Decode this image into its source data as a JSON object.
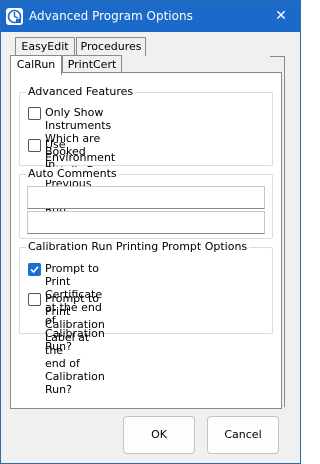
{
  "window": {
    "title": "Advanced Program Options",
    "close_glyph": "✕",
    "app_icon": "calibration-app-icon"
  },
  "tabs_back": [
    {
      "label": "EasyEdit"
    },
    {
      "label": "Procedures"
    }
  ],
  "tabs_front": [
    {
      "label": "CalRun",
      "active": true
    },
    {
      "label": "PrintCert",
      "active": false
    }
  ],
  "advanced_features": {
    "title": "Advanced Features",
    "options": [
      {
        "line1": "Only Show Instruments Which are Booked",
        "line2": "In.",
        "checked": false
      },
      {
        "line1": "Use Environment Details From Previous",
        "line2": "Calibration Run",
        "checked": false
      }
    ]
  },
  "auto_comments": {
    "title": "Auto Comments",
    "fields": [
      "",
      ""
    ]
  },
  "printing_prompts": {
    "title": "Calibration Run Printing Prompt Options",
    "options": [
      {
        "line1": "Prompt to Print Certificate at the end of",
        "line2": "Calibration Run?",
        "checked": true
      },
      {
        "line1": "Prompt to Print Calibration Label at the",
        "line2": "end of Calibration Run?",
        "checked": false
      }
    ]
  },
  "buttons": {
    "ok": "OK",
    "cancel": "Cancel"
  },
  "colors": {
    "titlebar": "#1b6ac9",
    "check_accent": "#1a6fcf"
  }
}
